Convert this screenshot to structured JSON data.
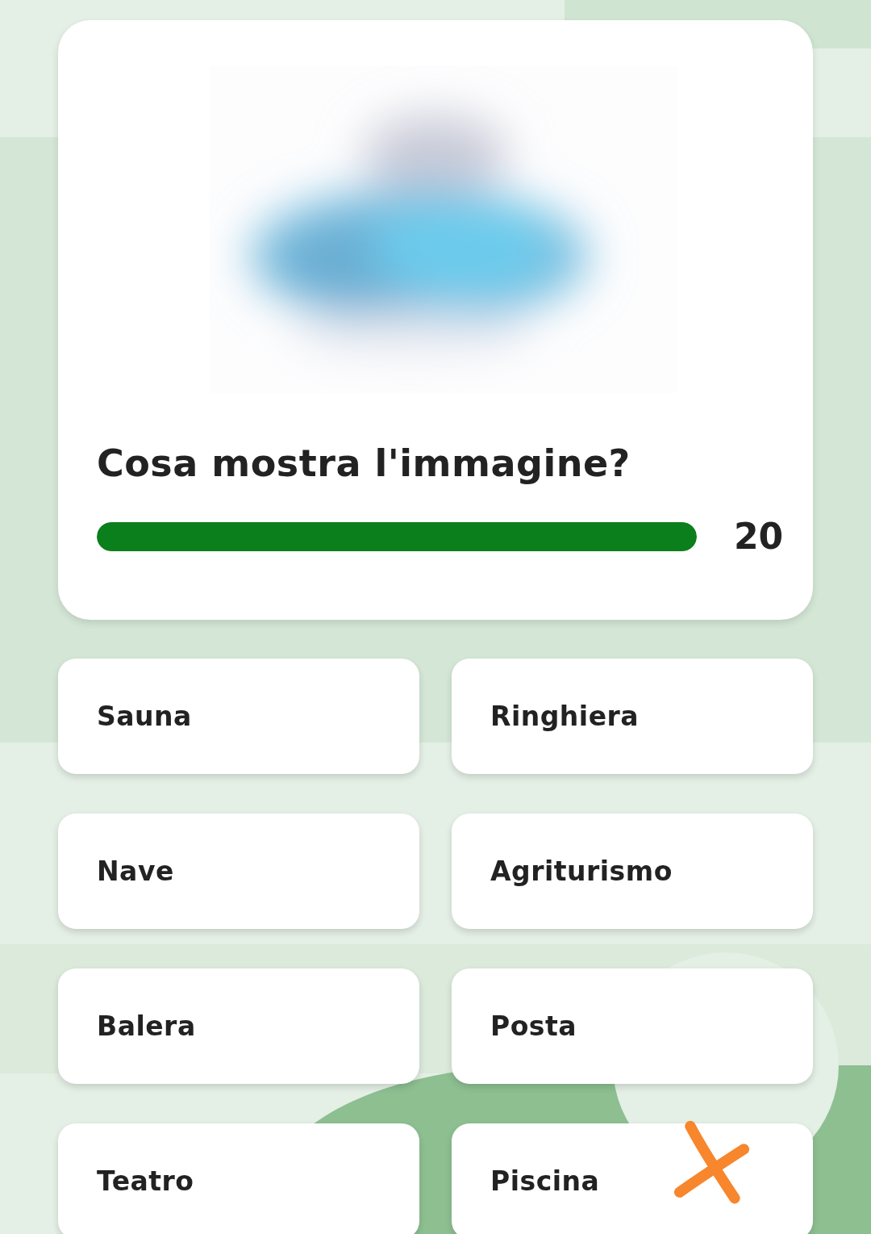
{
  "question_card": {
    "question": "Cosa mostra l'immagine?",
    "timer": {
      "level": 1.0,
      "reading": "20"
    }
  },
  "answers": [
    {
      "label": "Sauna",
      "marked": false
    },
    {
      "label": "Ringhiera",
      "marked": false
    },
    {
      "label": "Nave",
      "marked": false
    },
    {
      "label": "Agriturismo",
      "marked": false
    },
    {
      "label": "Balera",
      "marked": false
    },
    {
      "label": "Posta",
      "marked": false
    },
    {
      "label": "Teatro",
      "marked": false
    },
    {
      "label": "Piscina",
      "marked": true
    }
  ]
}
